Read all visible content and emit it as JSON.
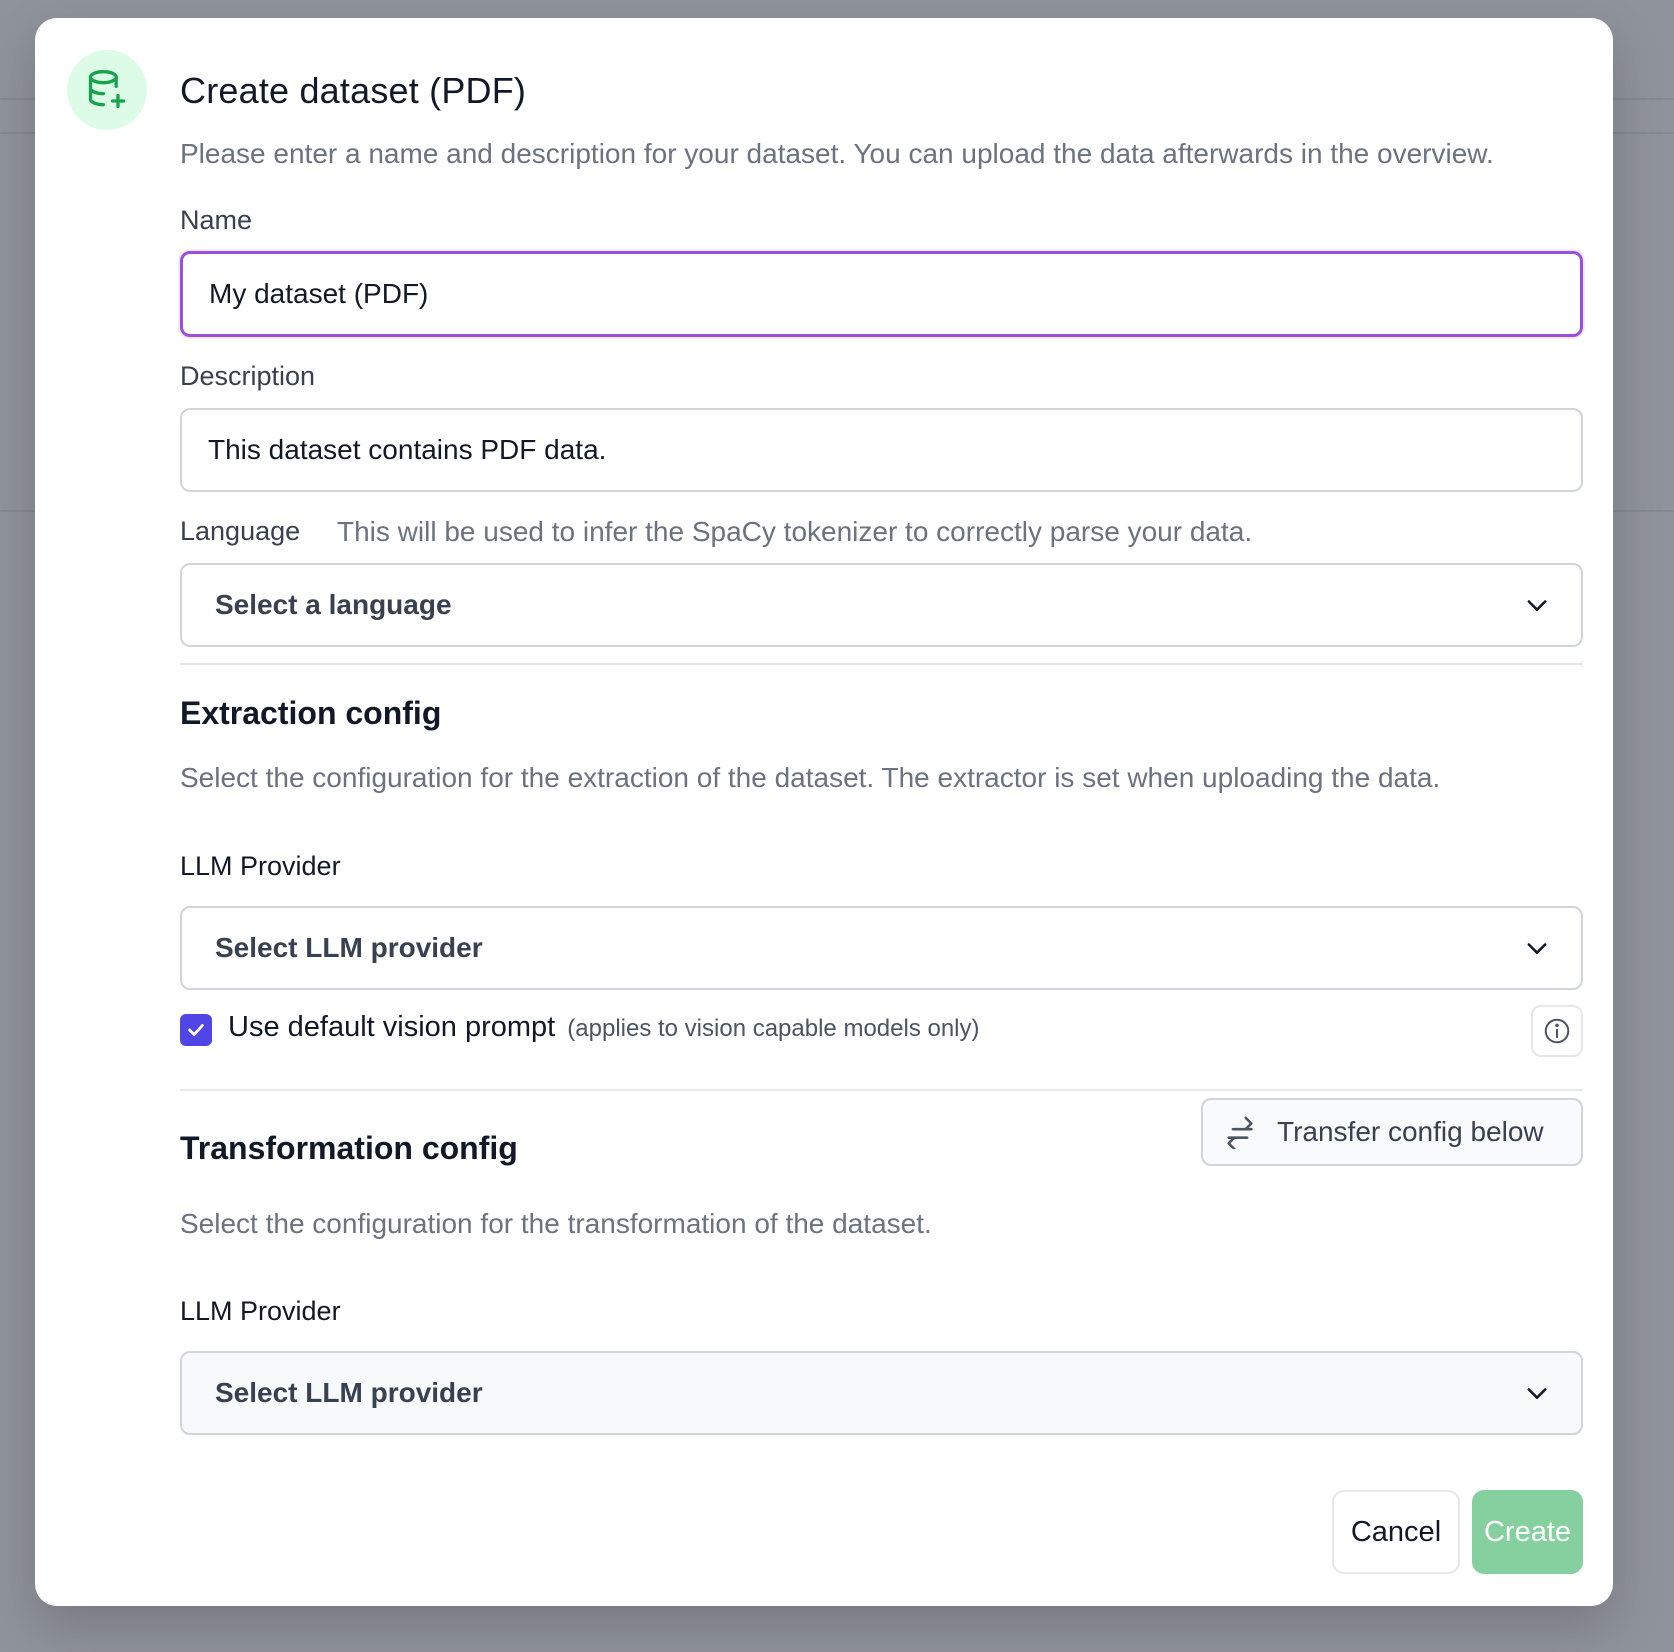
{
  "dialog": {
    "icon": "database-plus-icon",
    "title": "Create dataset (PDF)",
    "subtitle": "Please enter a name and description for your dataset. You can upload the data afterwards in the overview."
  },
  "form": {
    "name_label": "Name",
    "name_value": "My dataset (PDF)",
    "description_label": "Description",
    "description_value": "This dataset contains PDF data.",
    "language_label": "Language",
    "language_help": "This will be used to infer the SpaCy tokenizer to correctly parse your data.",
    "language_placeholder": "Select a language"
  },
  "extraction": {
    "title": "Extraction config",
    "description": "Select the configuration for the extraction of the dataset. The extractor is set when uploading the data.",
    "llm_label": "LLM Provider",
    "llm_placeholder": "Select LLM provider",
    "vision_checkbox_checked": true,
    "vision_label": "Use default vision prompt",
    "vision_note": "(applies to vision capable models only)"
  },
  "transformation": {
    "title": "Transformation config",
    "transfer_button": "Transfer config below",
    "description": "Select the configuration for the transformation of the dataset.",
    "llm_label": "LLM Provider",
    "llm_placeholder": "Select LLM provider"
  },
  "footer": {
    "cancel": "Cancel",
    "create": "Create"
  },
  "colors": {
    "accent_focus": "#9b4de0",
    "checkbox": "#4f46e5",
    "create_button_disabled": "#86d0a0",
    "icon_green": "#16a34a"
  }
}
